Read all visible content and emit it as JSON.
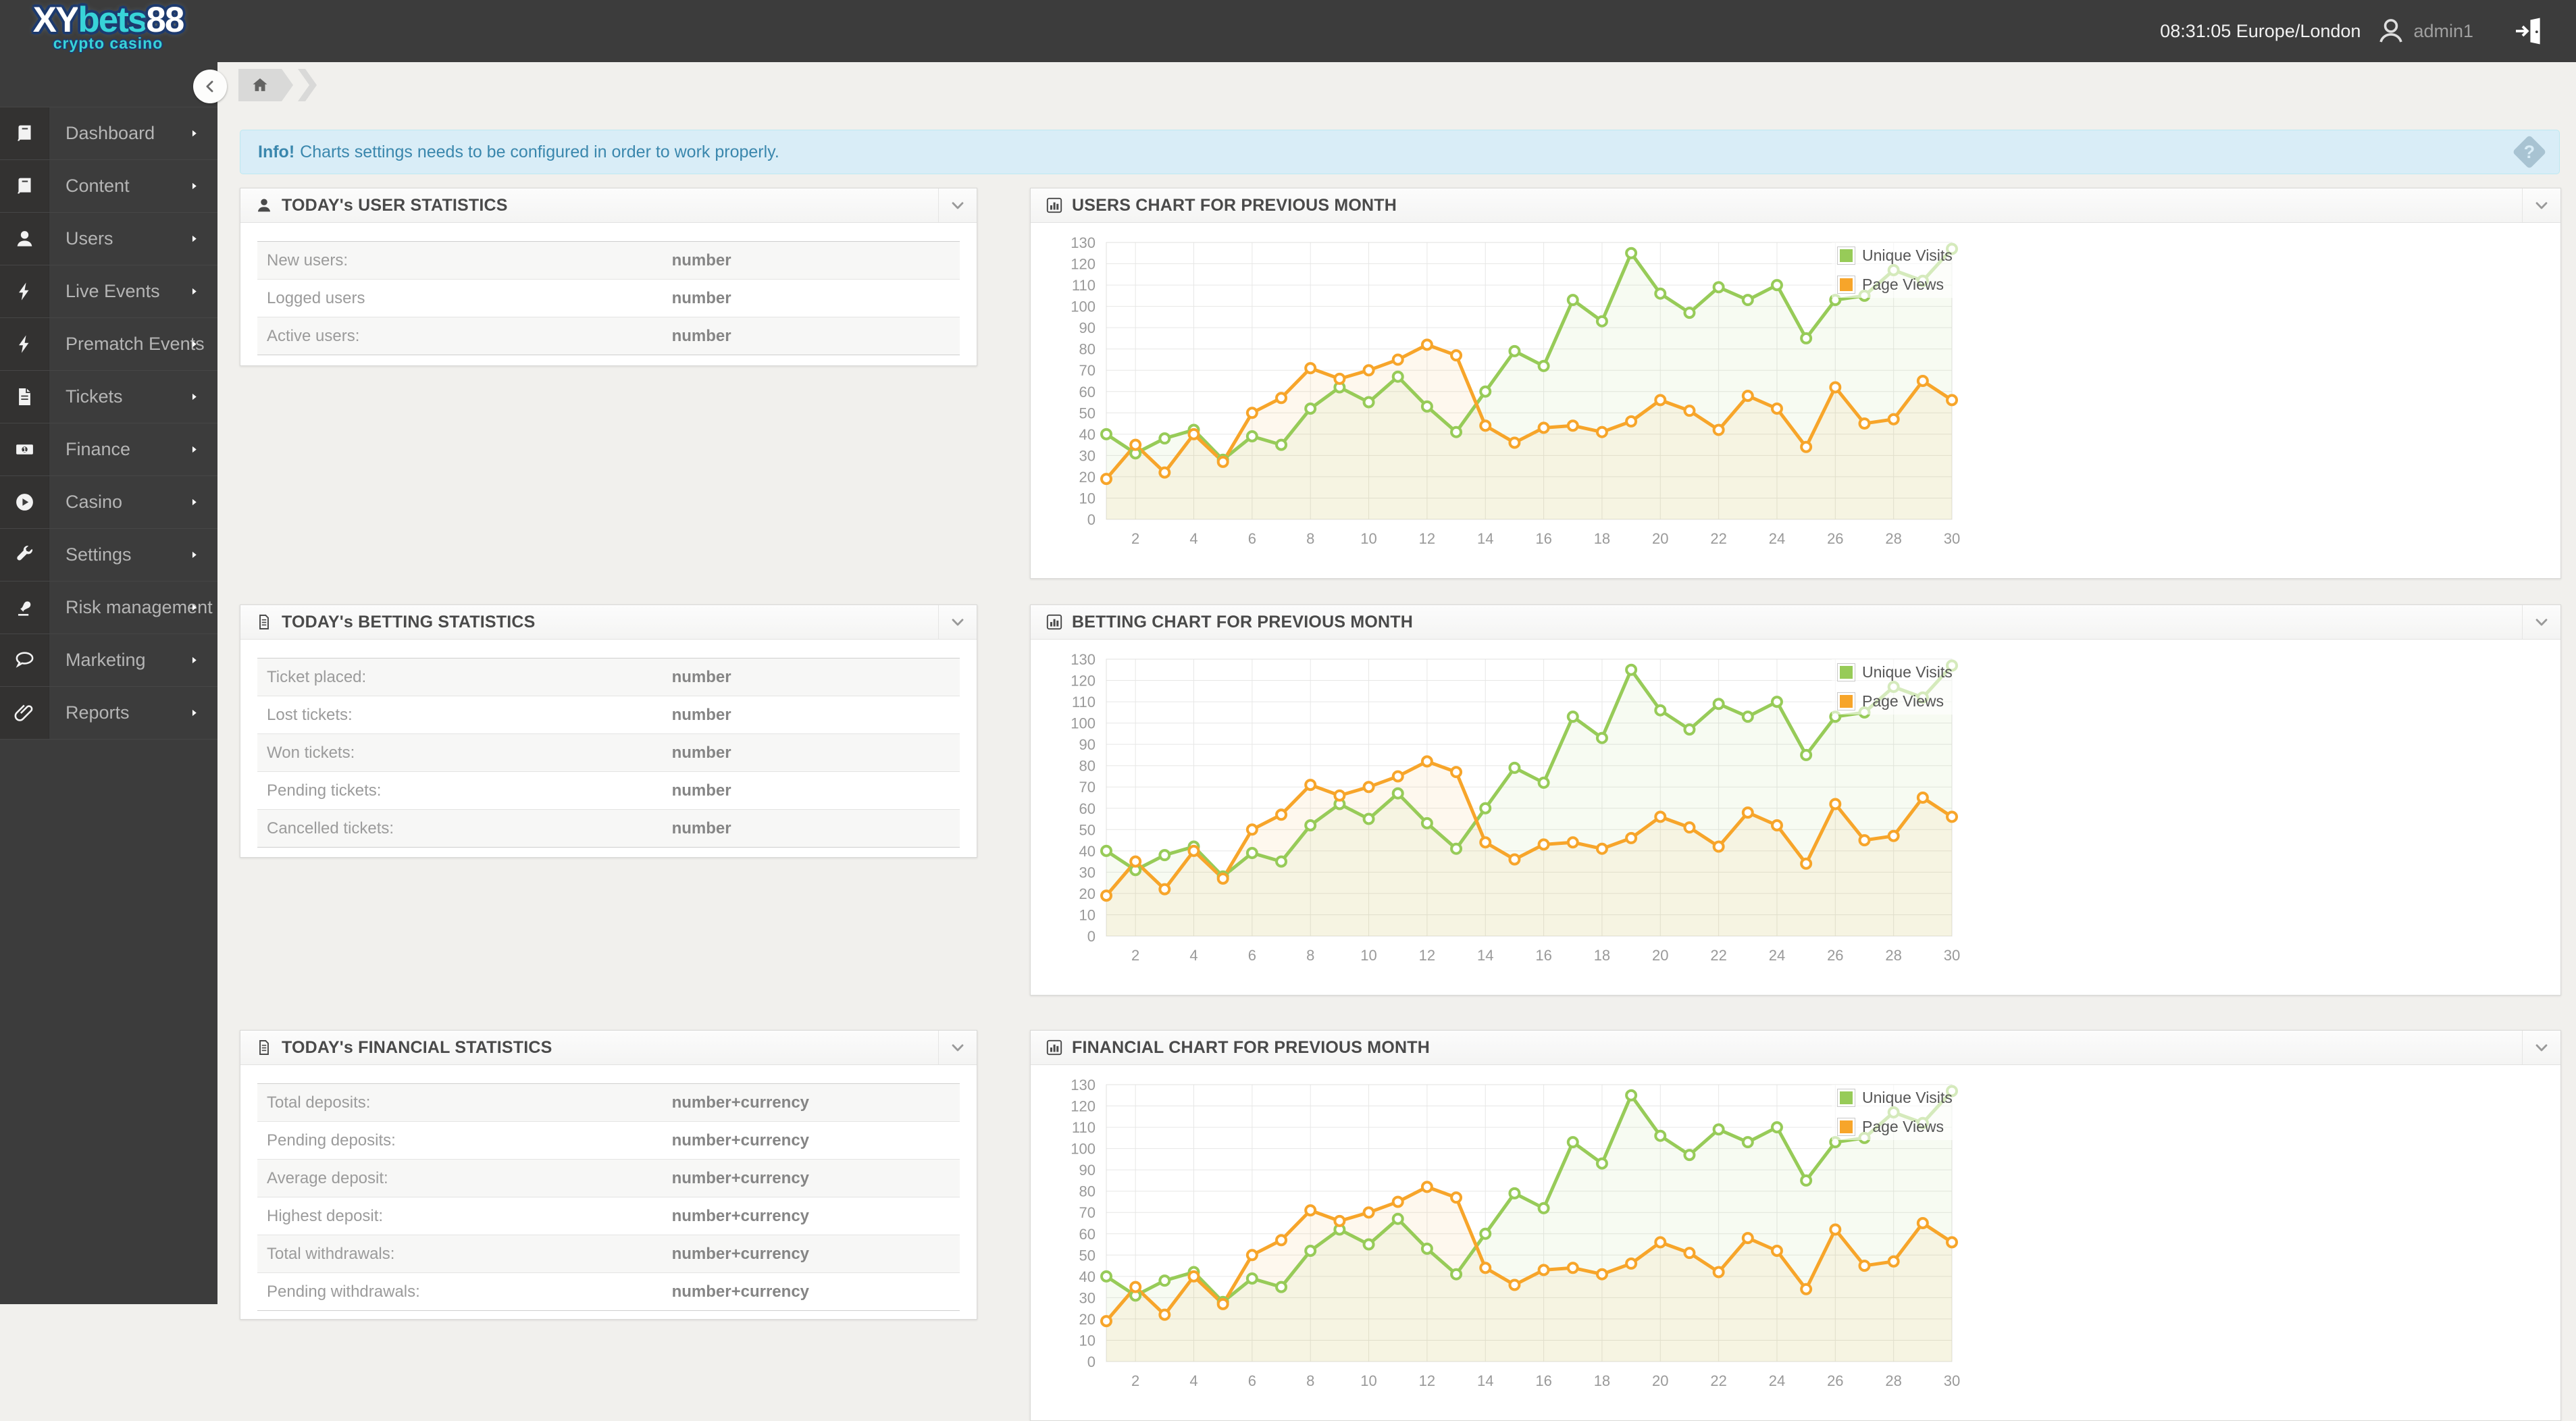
{
  "topbar": {
    "logo": {
      "text_primary": "XY",
      "text_accent": "bets",
      "text_suffix": "88",
      "tagline": "crypto casino"
    },
    "clock": "08:31:05 Europe/London",
    "username": "admin1"
  },
  "sidebar": {
    "items": [
      {
        "label": "Dashboard",
        "icon": "book-icon"
      },
      {
        "label": "Content",
        "icon": "book-icon"
      },
      {
        "label": "Users",
        "icon": "user-icon"
      },
      {
        "label": "Live Events",
        "icon": "bolt-icon"
      },
      {
        "label": "Prematch Events",
        "icon": "bolt-icon"
      },
      {
        "label": "Tickets",
        "icon": "file-icon"
      },
      {
        "label": "Finance",
        "icon": "money-icon"
      },
      {
        "label": "Casino",
        "icon": "play-icon"
      },
      {
        "label": "Settings",
        "icon": "wrench-icon"
      },
      {
        "label": "Risk management",
        "icon": "stamp-icon"
      },
      {
        "label": "Marketing",
        "icon": "chat-icon"
      },
      {
        "label": "Reports",
        "icon": "paperclip-icon"
      }
    ]
  },
  "alert": {
    "prefix": "Info!",
    "message": "Charts settings needs to be configured in order to work properly."
  },
  "stats_panels": [
    {
      "title": "TODAY's USER STATISTICS",
      "icon": "user-icon",
      "rows": [
        {
          "label": "New users:",
          "value": "number"
        },
        {
          "label": "Logged users",
          "value": "number"
        },
        {
          "label": "Active users:",
          "value": "number"
        }
      ]
    },
    {
      "title": "TODAY's BETTING STATISTICS",
      "icon": "doc-icon",
      "rows": [
        {
          "label": "Ticket placed:",
          "value": "number"
        },
        {
          "label": "Lost tickets:",
          "value": "number"
        },
        {
          "label": "Won tickets:",
          "value": "number"
        },
        {
          "label": "Pending tickets:",
          "value": "number"
        },
        {
          "label": "Cancelled tickets:",
          "value": "number"
        }
      ]
    },
    {
      "title": "TODAY's FINANCIAL STATISTICS",
      "icon": "doc-icon",
      "rows": [
        {
          "label": "Total deposits:",
          "value": "number+currency"
        },
        {
          "label": "Pending deposits:",
          "value": "number+currency"
        },
        {
          "label": "Average deposit:",
          "value": "number+currency"
        },
        {
          "label": "Highest deposit:",
          "value": "number+currency"
        },
        {
          "label": "Total withdrawals:",
          "value": "number+currency"
        },
        {
          "label": "Pending withdrawals:",
          "value": "number+currency"
        }
      ]
    }
  ],
  "chart_panels": [
    {
      "title": "USERS CHART FOR PREVIOUS MONTH",
      "icon": "chart-icon"
    },
    {
      "title": "BETTING CHART FOR PREVIOUS MONTH",
      "icon": "chart-icon"
    },
    {
      "title": "FINANCIAL CHART FOR PREVIOUS MONTH",
      "icon": "chart-icon"
    }
  ],
  "chart_data": {
    "type": "line",
    "x": [
      1,
      2,
      3,
      4,
      5,
      6,
      7,
      8,
      9,
      10,
      11,
      12,
      13,
      14,
      15,
      16,
      17,
      18,
      19,
      20,
      21,
      22,
      23,
      24,
      25,
      26,
      27,
      28,
      29,
      30
    ],
    "xticks": [
      2,
      4,
      6,
      8,
      10,
      12,
      14,
      16,
      18,
      20,
      22,
      24,
      26,
      28,
      30
    ],
    "ylim": [
      0,
      130
    ],
    "ytick_step": 10,
    "grid": true,
    "legend_position": "top-right",
    "series": [
      {
        "name": "Unique Visits",
        "color": "#97CB58",
        "values": [
          40,
          31,
          38,
          42,
          28,
          39,
          35,
          52,
          62,
          55,
          67,
          53,
          41,
          60,
          79,
          72,
          103,
          93,
          125,
          106,
          97,
          109,
          103,
          110,
          85,
          103,
          105,
          117,
          112,
          127
        ]
      },
      {
        "name": "Page Views",
        "color": "#F7A52A",
        "values": [
          19,
          35,
          22,
          40,
          27,
          50,
          57,
          71,
          66,
          70,
          75,
          82,
          77,
          44,
          36,
          43,
          44,
          41,
          46,
          56,
          51,
          42,
          58,
          52,
          34,
          62,
          45,
          47,
          65,
          56
        ]
      }
    ]
  },
  "colors": {
    "topbar_bg": "#3c3c3c",
    "accent_cyan": "#38d3d8",
    "series_green": "#97CB58",
    "series_orange": "#F7A52A",
    "alert_bg": "#d9edf7",
    "alert_text": "#3a87ad"
  }
}
